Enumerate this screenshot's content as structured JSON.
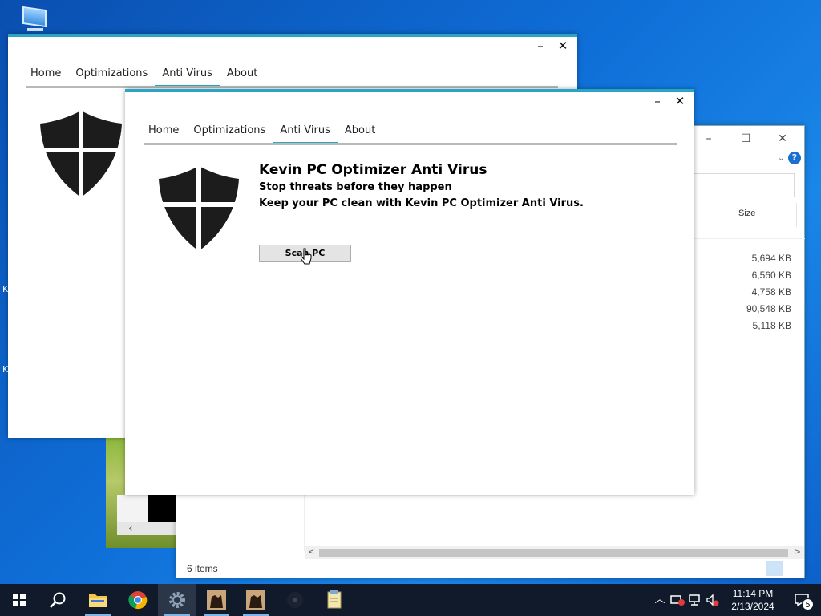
{
  "app": {
    "nav": [
      "Home",
      "Optimizations",
      "Anti Virus",
      "About"
    ],
    "active_tab": "Anti Virus",
    "title": "Kevin PC Optimizer Anti Virus",
    "subtitle": "Stop threats before they happen",
    "tagline": "Keep your PC clean with Kevin PC Optimizer Anti Virus.",
    "scan_button": "Scan PC",
    "window_controls": {
      "minimize": "–",
      "close": "✕"
    },
    "accent_color": "#2aa6c4"
  },
  "explorer": {
    "column_header": "Size",
    "file_sizes": [
      "5,694 KB",
      "6,560 KB",
      "4,758 KB",
      "90,548 KB",
      "5,118 KB"
    ],
    "status": "6 items",
    "window_controls": {
      "minimize": "–",
      "maximize": "☐",
      "close": "✕"
    }
  },
  "taskbar": {
    "time": "11:14 PM",
    "date": "2/13/2024",
    "notification_count": "5",
    "icons": [
      "start-icon",
      "search-icon",
      "file-explorer-icon",
      "chrome-icon",
      "settings-gear-icon",
      "pinned-app-icon",
      "pinned-app-icon",
      "media-icon",
      "notepad-files-icon"
    ]
  }
}
